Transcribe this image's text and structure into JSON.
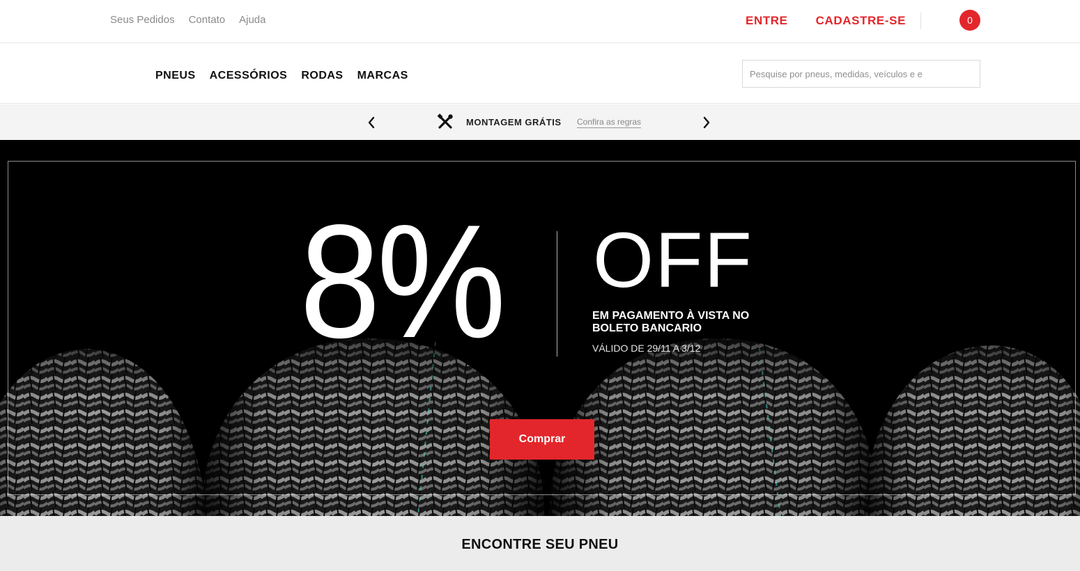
{
  "header": {
    "top_links": [
      "Seus Pedidos",
      "Contato",
      "Ajuda"
    ],
    "login_label": "ENTRE",
    "signup_label": "CADASTRE-SE",
    "cart_count": "0"
  },
  "nav": {
    "items": [
      "PNEUS",
      "ACESSÓRIOS",
      "RODAS",
      "MARCAS"
    ],
    "search_placeholder": "Pesquise por pneus, medidas, veículos e e"
  },
  "promo_strip": {
    "icon": "tools-icon",
    "title": "MONTAGEM GRÁTIS",
    "link": "Confira as regras"
  },
  "hero": {
    "discount": "8%",
    "off": "OFF",
    "subline": "EM PAGAMENTO À VISTA NO BOLETO BANCARIO",
    "validity": "VÁLIDO DE 29/11 A 3/12",
    "cta": "Comprar"
  },
  "finder": {
    "title": "ENCONTRE SEU PNEU"
  },
  "colors": {
    "accent": "#e3262b",
    "hero_bg": "#000000",
    "strip_bg": "#f4f4f4",
    "finder_bg": "#ececec"
  }
}
